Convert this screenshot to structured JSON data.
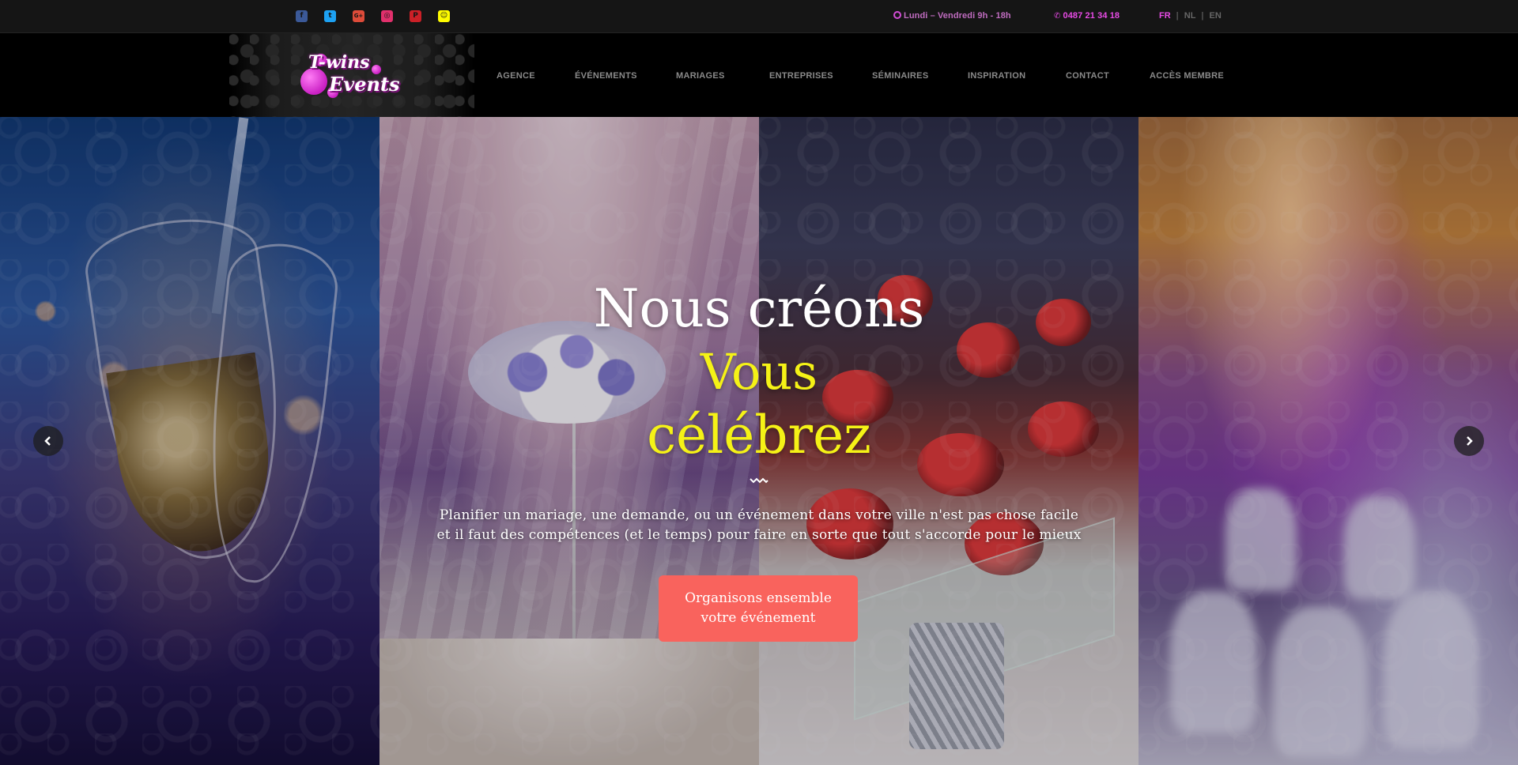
{
  "topbar": {
    "social": [
      {
        "name": "facebook-icon",
        "glyph": "f",
        "color": "#3b5998"
      },
      {
        "name": "twitter-icon",
        "glyph": "t",
        "color": "#1da1f2"
      },
      {
        "name": "google-plus-icon",
        "glyph": "G+",
        "color": "#dd4b39"
      },
      {
        "name": "instagram-icon",
        "glyph": "◎",
        "color": "#e1306c"
      },
      {
        "name": "pinterest-icon",
        "glyph": "P",
        "color": "#cb2027"
      },
      {
        "name": "snapchat-icon",
        "glyph": "☺",
        "color": "#fffc00"
      }
    ],
    "hours": "Lundi – Vendredi 9h - 18h",
    "phone": "0487 21 34 18",
    "languages": [
      "FR",
      "NL",
      "EN"
    ],
    "active_language": "FR"
  },
  "header": {
    "logo": {
      "line1": "T-wins",
      "line2": "Events"
    },
    "nav": [
      "AGENCE",
      "ÉVÉNEMENTS",
      "MARIAGES",
      "ENTREPRISES",
      "SÉMINAIRES",
      "INSPIRATION",
      "CONTACT",
      "ACCÈS MEMBRE"
    ]
  },
  "hero": {
    "title_line1": "Nous créons",
    "title_line2": "Vous",
    "title_line3": "célébrez",
    "description_line1": "Planifier un mariage, une demande, ou un événement dans votre ville n'est pas chose facile",
    "description_line2": "et il faut des compétences (et le temps) pour faire en sorte que tout s'accorde pour le mieux",
    "cta_line1": "Organisons ensemble",
    "cta_line2": "votre événement"
  },
  "colors": {
    "accent": "#e84be6",
    "title_highlight": "#f5f216",
    "cta": "#f9635d",
    "topbar": "#151515"
  }
}
